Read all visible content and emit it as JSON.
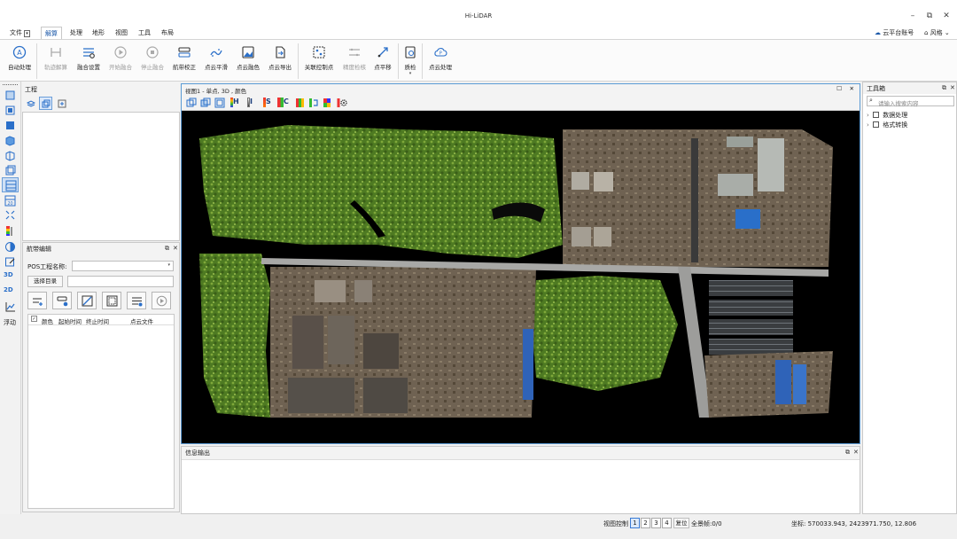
{
  "app": {
    "title": "Hi-LiDAR"
  },
  "menu": {
    "file": "文件",
    "tabs": [
      "解算",
      "处理",
      "地形",
      "视图",
      "工具",
      "布局"
    ],
    "cloud_account": "云平台账号",
    "style": "风格"
  },
  "ribbon": {
    "buttons": [
      {
        "label": "自动处理",
        "enabled": true
      },
      {
        "label": "轨迹解算",
        "enabled": false
      },
      {
        "label": "融合设置",
        "enabled": true
      },
      {
        "label": "开始融合",
        "enabled": false
      },
      {
        "label": "停止融合",
        "enabled": false
      },
      {
        "label": "航带校正",
        "enabled": true
      },
      {
        "label": "点云平滑",
        "enabled": true
      },
      {
        "label": "点云融色",
        "enabled": true
      },
      {
        "label": "点云导出",
        "enabled": true
      },
      {
        "label": "关联控制点",
        "enabled": true
      },
      {
        "label": "精度检核",
        "enabled": false
      },
      {
        "label": "点平移",
        "enabled": true
      },
      {
        "label": "质检",
        "enabled": true
      },
      {
        "label": "点云处理",
        "enabled": true
      }
    ]
  },
  "left_strip": {
    "float_label": "浮动"
  },
  "project_panel": {
    "title": "工程"
  },
  "route_panel": {
    "title": "航带编辑",
    "pos_label": "POS工程名称:",
    "pos_value": "",
    "select_dir_button": "选择目录",
    "dir_value": "",
    "columns": [
      "颜色",
      "起始时间",
      "终止时间",
      "点云文件"
    ]
  },
  "viewport": {
    "header": "视图1 - 单点, 3D , 颜色",
    "toolbar": [
      "H",
      "I",
      "S",
      "C"
    ]
  },
  "output_panel": {
    "title": "信息输出"
  },
  "toolbox": {
    "title": "工具箱",
    "search_placeholder": "请输入搜索内容",
    "items": [
      "数据处理",
      "格式转换"
    ]
  },
  "status": {
    "view_control_label": "视图控制",
    "pages": [
      "1",
      "2",
      "3",
      "4"
    ],
    "selected_page": "1",
    "reset_button": "复位",
    "full_view": "全景帧:0/0",
    "coords": "坐标: 570033.943, 2423971.750, 12.806"
  },
  "colors": {
    "accent": "#1a57a8",
    "viewport_border": "#5b9bd5",
    "viewport_bg": "#000000"
  }
}
